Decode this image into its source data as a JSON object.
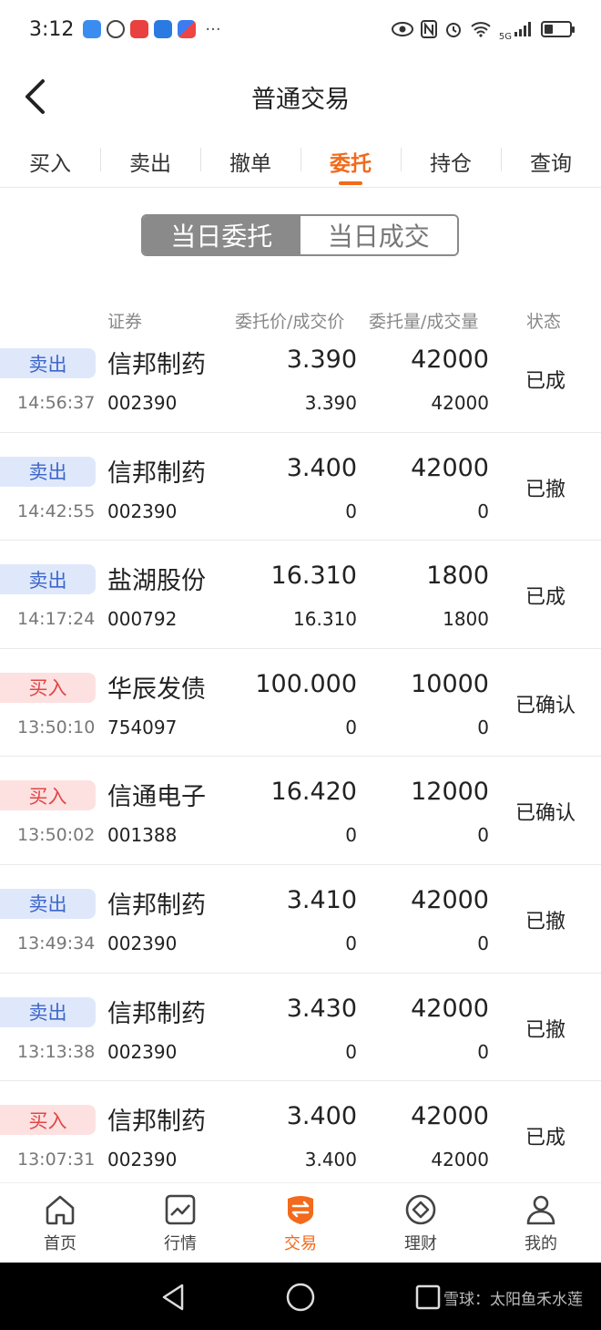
{
  "status_bar": {
    "time": "3:12",
    "more": "···",
    "network": "5G"
  },
  "header": {
    "title": "普通交易"
  },
  "tabs": [
    {
      "label": "买入",
      "active": false
    },
    {
      "label": "卖出",
      "active": false
    },
    {
      "label": "撤单",
      "active": false
    },
    {
      "label": "委托",
      "active": true
    },
    {
      "label": "持仓",
      "active": false
    },
    {
      "label": "查询",
      "active": false
    }
  ],
  "segment": {
    "left": "当日委托",
    "right": "当日成交",
    "active": "left"
  },
  "columns": {
    "security": "证券",
    "price": "委托价/成交价",
    "qty": "委托量/成交量",
    "status": "状态"
  },
  "orders": [
    {
      "side": "卖出",
      "side_type": "sell",
      "time": "14:56:37",
      "name": "信邦制药",
      "code": "002390",
      "price": "3.390",
      "deal_price": "3.390",
      "qty": "42000",
      "deal_qty": "42000",
      "status": "已成"
    },
    {
      "side": "卖出",
      "side_type": "sell",
      "time": "14:42:55",
      "name": "信邦制药",
      "code": "002390",
      "price": "3.400",
      "deal_price": "0",
      "qty": "42000",
      "deal_qty": "0",
      "status": "已撤"
    },
    {
      "side": "卖出",
      "side_type": "sell",
      "time": "14:17:24",
      "name": "盐湖股份",
      "code": "000792",
      "price": "16.310",
      "deal_price": "16.310",
      "qty": "1800",
      "deal_qty": "1800",
      "status": "已成"
    },
    {
      "side": "买入",
      "side_type": "buy",
      "time": "13:50:10",
      "name": "华辰发债",
      "code": "754097",
      "price": "100.000",
      "deal_price": "0",
      "qty": "10000",
      "deal_qty": "0",
      "status": "已确认"
    },
    {
      "side": "买入",
      "side_type": "buy",
      "time": "13:50:02",
      "name": "信通电子",
      "code": "001388",
      "price": "16.420",
      "deal_price": "0",
      "qty": "12000",
      "deal_qty": "0",
      "status": "已确认"
    },
    {
      "side": "卖出",
      "side_type": "sell",
      "time": "13:49:34",
      "name": "信邦制药",
      "code": "002390",
      "price": "3.410",
      "deal_price": "0",
      "qty": "42000",
      "deal_qty": "0",
      "status": "已撤"
    },
    {
      "side": "卖出",
      "side_type": "sell",
      "time": "13:13:38",
      "name": "信邦制药",
      "code": "002390",
      "price": "3.430",
      "deal_price": "0",
      "qty": "42000",
      "deal_qty": "0",
      "status": "已撤"
    },
    {
      "side": "买入",
      "side_type": "buy",
      "time": "13:07:31",
      "name": "信邦制药",
      "code": "002390",
      "price": "3.400",
      "deal_price": "3.400",
      "qty": "42000",
      "deal_qty": "42000",
      "status": "已成"
    }
  ],
  "bottom_nav": [
    {
      "label": "首页",
      "icon": "home-icon",
      "active": false
    },
    {
      "label": "行情",
      "icon": "chart-icon",
      "active": false
    },
    {
      "label": "交易",
      "icon": "trade-icon",
      "active": true
    },
    {
      "label": "理财",
      "icon": "diamond-icon",
      "active": false
    },
    {
      "label": "我的",
      "icon": "user-icon",
      "active": false
    }
  ],
  "watermark": "雪球：太阳鱼禾水莲",
  "colors": {
    "accent": "#f26a1b",
    "sell_bg": "#dfe8fb",
    "sell_text": "#3c66c9",
    "buy_bg": "#fde1e1",
    "buy_text": "#e04747"
  }
}
